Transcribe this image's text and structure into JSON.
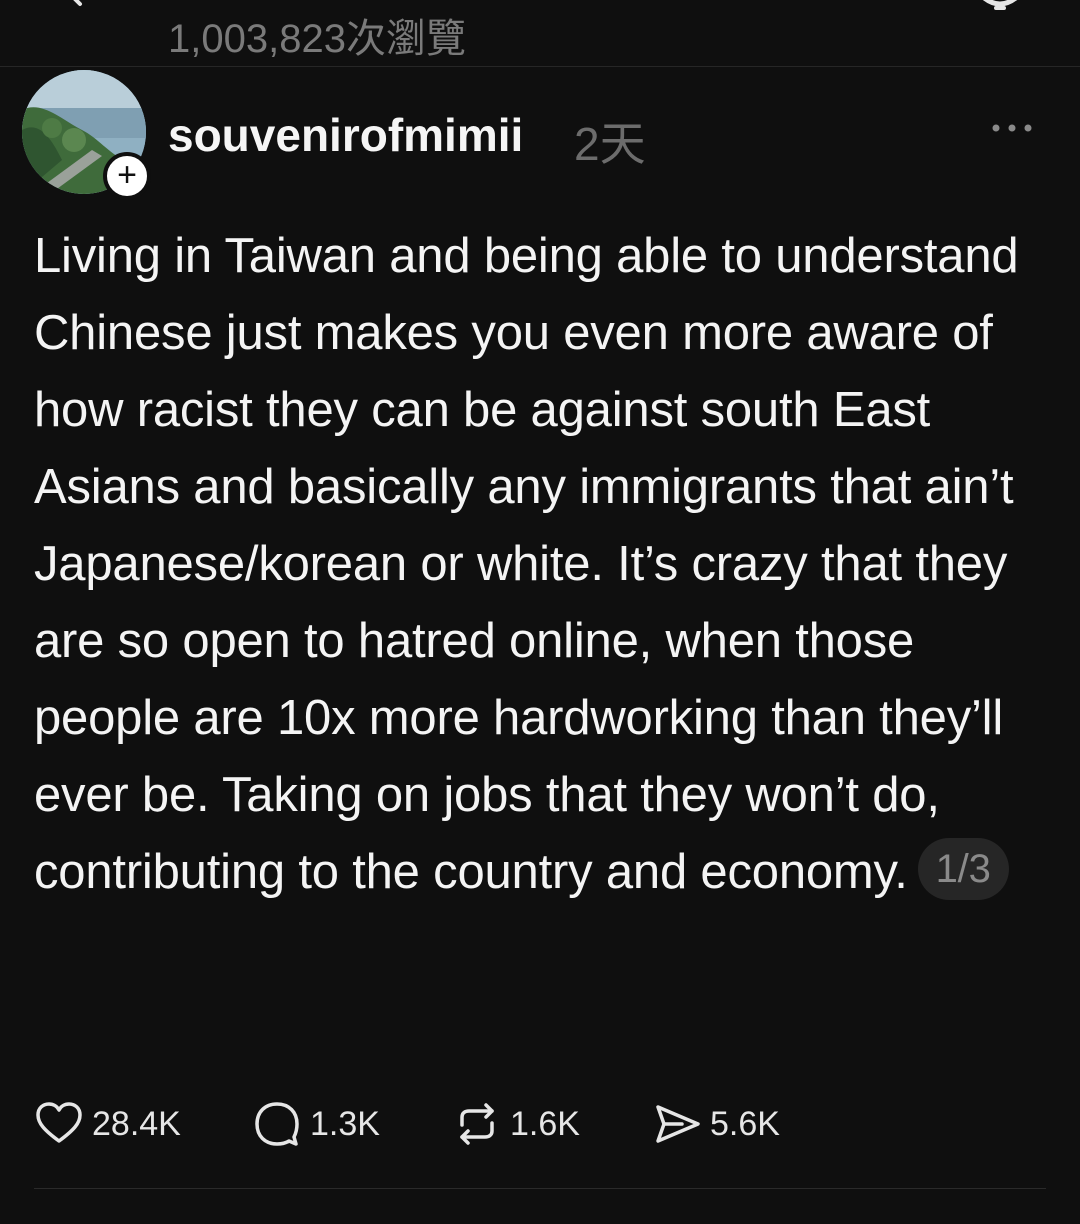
{
  "header": {
    "views_label": "1,003,823次瀏覽"
  },
  "post": {
    "username": "souvenirofmimii",
    "time": "2天",
    "body": "Living in Taiwan and being able to understand Chinese just makes you even more aware of how racist they can be against south East Asians and basically any immigrants that ain’t Japanese/korean or white. It’s crazy that they are so open to hatred online, when those people are 10x more hardworking than they’ll ever be. Taking on jobs that they won’t do, contributing to the country and economy.",
    "page_indicator": "1/3",
    "follow_symbol": "+"
  },
  "actions": {
    "likes": "28.4K",
    "comments": "1.3K",
    "reposts": "1.6K",
    "shares": "5.6K"
  },
  "icons": [
    "back-icon",
    "top-right-icon",
    "follow-plus-icon",
    "more-icon",
    "heart-icon",
    "comment-icon",
    "repost-icon",
    "share-icon"
  ],
  "colors": {
    "background": "#0f0f0f",
    "text": "#f4f4f4",
    "muted": "#6c6c6c"
  }
}
